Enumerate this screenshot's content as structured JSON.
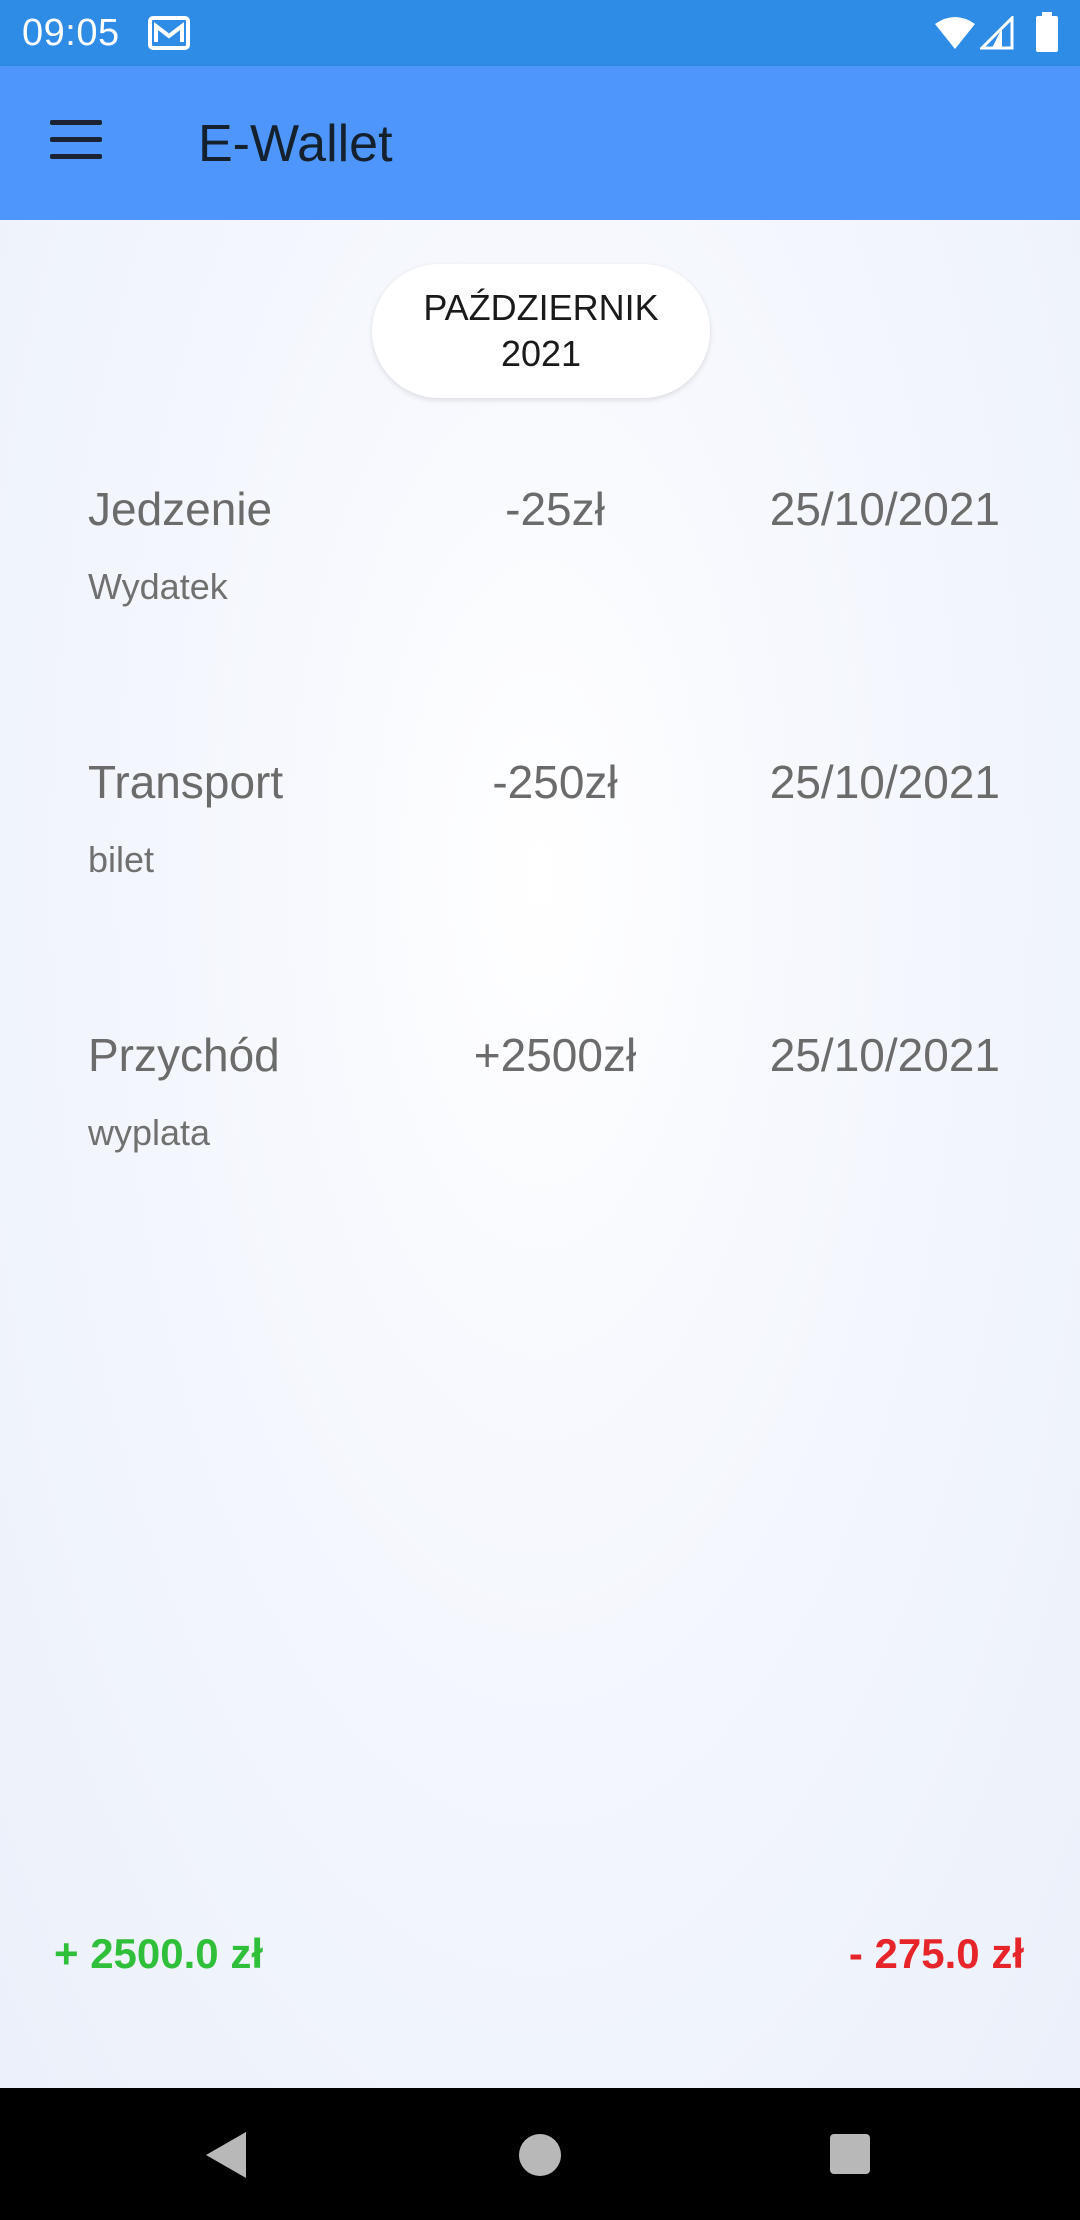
{
  "status_bar": {
    "time": "09:05",
    "icons": [
      "mail-icon",
      "wifi-icon",
      "signal-icon",
      "battery-icon"
    ]
  },
  "app_bar": {
    "title": "E-Wallet",
    "menu_icon": "hamburger-menu-icon",
    "color": "#4e96fb"
  },
  "month_selector": {
    "month": "PAŹDZIERNIK",
    "year": "2021"
  },
  "transactions": [
    {
      "category": "Jedzenie",
      "note": "Wydatek",
      "amount": "-25zł",
      "date": "25/10/2021"
    },
    {
      "category": "Transport",
      "note": "bilet",
      "amount": "-250zł",
      "date": "25/10/2021"
    },
    {
      "category": "Przychód",
      "note": "wyplata",
      "amount": "+2500zł",
      "date": "25/10/2021"
    }
  ],
  "totals": {
    "income": "+ 2500.0 zł",
    "expense": "- 275.0 zł",
    "income_color": "#2fbf3b",
    "expense_color": "#e5252a"
  },
  "nav_bar": {
    "icons": [
      "back-icon",
      "home-icon",
      "recents-icon"
    ]
  }
}
